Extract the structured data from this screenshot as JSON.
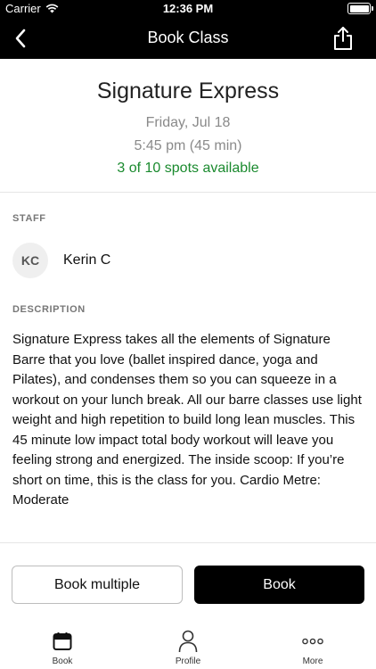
{
  "status_bar": {
    "carrier": "Carrier",
    "time": "12:36 PM"
  },
  "nav": {
    "title": "Book Class"
  },
  "class_info": {
    "name": "Signature Express",
    "date": "Friday, Jul 18",
    "time": "5:45 pm (45 min)",
    "spots": "3 of 10 spots available"
  },
  "staff": {
    "section_label": "STAFF",
    "initials": "KC",
    "name": "Kerin C"
  },
  "description": {
    "section_label": "DESCRIPTION",
    "text": "Signature Express takes all the elements of Signature Barre that you love (ballet inspired dance, yoga and Pilates), and condenses them so you can squeeze in a workout on your lunch break. All our barre classes use light weight and high repetition to build long lean muscles. This 45 minute low impact total body workout will leave you feeling strong and energized. The inside scoop: If you’re short on time, this is the class for you. Cardio Metre: Moderate"
  },
  "actions": {
    "book_multiple": "Book multiple",
    "book": "Book"
  },
  "tab_bar": {
    "items": [
      {
        "label": "Book",
        "icon": "calendar-icon"
      },
      {
        "label": "Profile",
        "icon": "person-icon"
      },
      {
        "label": "More",
        "icon": "ellipsis-icon"
      }
    ]
  },
  "colors": {
    "accent": "#000000",
    "spots_available": "#1a8a2e"
  }
}
